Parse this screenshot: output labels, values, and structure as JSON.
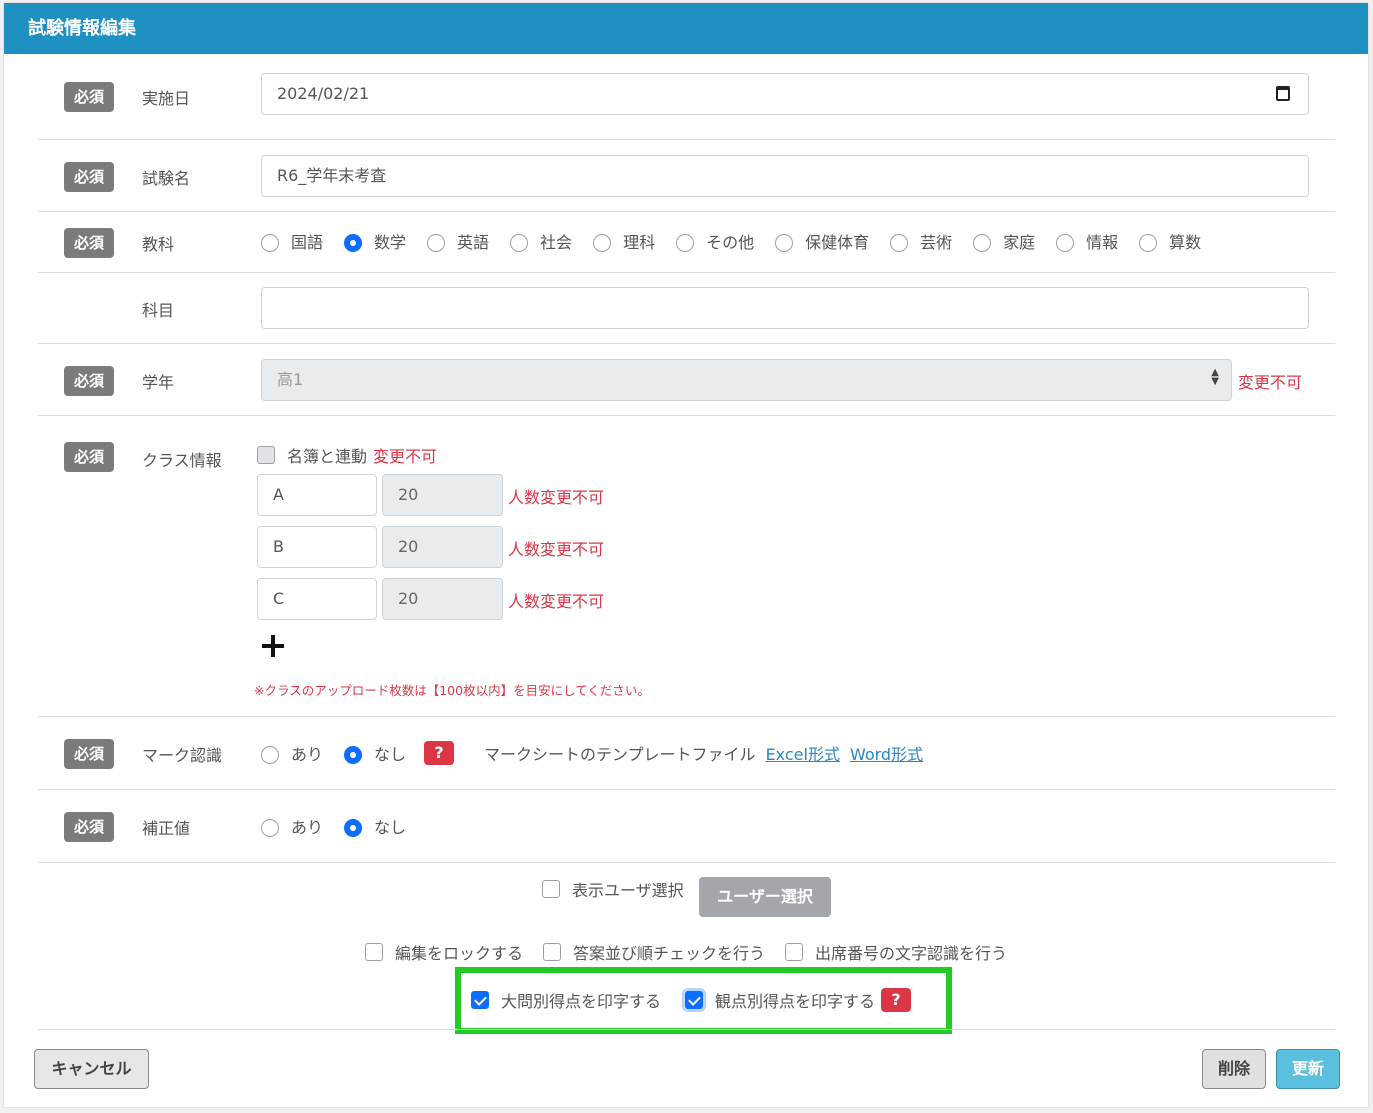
{
  "header": {
    "title": "試験情報編集"
  },
  "required_badge": "必須",
  "fields": {
    "date": {
      "label": "実施日",
      "value": "2024/02/21"
    },
    "name": {
      "label": "試験名",
      "value": "R6_学年末考査"
    },
    "subject": {
      "label": "教科",
      "options": [
        "国語",
        "数学",
        "英語",
        "社会",
        "理科",
        "その他",
        "保健体育",
        "芸術",
        "家庭",
        "情報",
        "算数"
      ],
      "selected": "数学"
    },
    "course": {
      "label": "科目",
      "value": ""
    },
    "grade": {
      "label": "学年",
      "value": "高1",
      "note": "変更不可"
    },
    "class_info": {
      "label": "クラス情報",
      "link_label": "名簿と連動",
      "link_note": "変更不可",
      "classes": [
        {
          "name": "A",
          "count": "20",
          "note": "人数変更不可"
        },
        {
          "name": "B",
          "count": "20",
          "note": "人数変更不可"
        },
        {
          "name": "C",
          "count": "20",
          "note": "人数変更不可"
        }
      ],
      "add_icon": "plus-icon",
      "notice": "※クラスのアップロード枚数は【100枚以内】を目安にしてください。"
    },
    "mark_recognition": {
      "label": "マーク認識",
      "options": [
        "あり",
        "なし"
      ],
      "selected": "なし",
      "help": "?",
      "template_label": "マークシートのテンプレートファイル",
      "excel_link": "Excel形式",
      "word_link": "Word形式"
    },
    "correction": {
      "label": "補正値",
      "options": [
        "あり",
        "なし"
      ],
      "selected": "なし"
    }
  },
  "options": {
    "display_user": {
      "label": "表示ユーザ選択",
      "checked": false
    },
    "user_select_button": "ユーザー選択",
    "lock_edit": {
      "label": "編集をロックする",
      "checked": false
    },
    "answer_order_check": {
      "label": "答案並び順チェックを行う",
      "checked": false
    },
    "attendance_ocr": {
      "label": "出席番号の文字認識を行う",
      "checked": false
    },
    "print_section_score": {
      "label": "大問別得点を印字する",
      "checked": true
    },
    "print_viewpoint_score": {
      "label": "観点別得点を印字する",
      "checked": true
    },
    "help": "?"
  },
  "footer": {
    "cancel": "キャンセル",
    "delete": "削除",
    "update": "更新"
  },
  "colors": {
    "header": "#1e90c2",
    "highlight_box": "#22cc22",
    "error": "#dc3545",
    "update_button": "#5bc0de"
  }
}
